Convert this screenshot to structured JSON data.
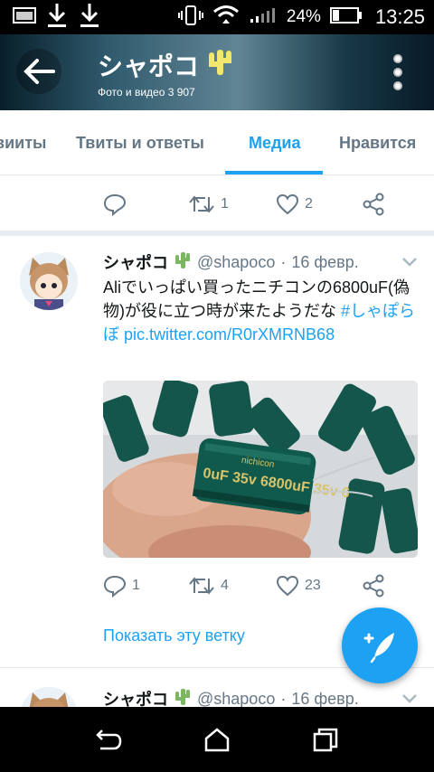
{
  "status_bar": {
    "battery": "24%",
    "time": "13:25"
  },
  "header": {
    "title": "シャポコ",
    "subtitle": "Фото и видео 3 907"
  },
  "tabs": [
    {
      "label": "вииты",
      "active": false
    },
    {
      "label": "Твиты и ответы",
      "active": false
    },
    {
      "label": "Медиа",
      "active": true
    },
    {
      "label": "Нравится",
      "active": false
    }
  ],
  "partial_tweet": {
    "retweets": "1",
    "likes": "2"
  },
  "tweet": {
    "name": "シャポコ",
    "handle": "@shapoco",
    "separator": "·",
    "date": "16 февр.",
    "text_plain": "Aliでいっぱい買ったニチコンの6800uF(偽物)が役に立つ時が来たようだな ",
    "hashtag": "#しゃぽらぼ",
    "link": "pic.twitter.com/R0rXMRNB68",
    "media_text": [
      "0uF 35v 6800uF 35v 6",
      "nichicon"
    ],
    "replies": "1",
    "retweets": "4",
    "likes": "23",
    "show_thread": "Показать эту ветку"
  },
  "next_tweet": {
    "name": "シャポコ",
    "handle": "@shapoco",
    "separator": "·",
    "date": "16 февр."
  },
  "colors": {
    "accent": "#1da1f2",
    "text": "#14171a",
    "muted": "#657786",
    "divider": "#e1e8ed"
  }
}
